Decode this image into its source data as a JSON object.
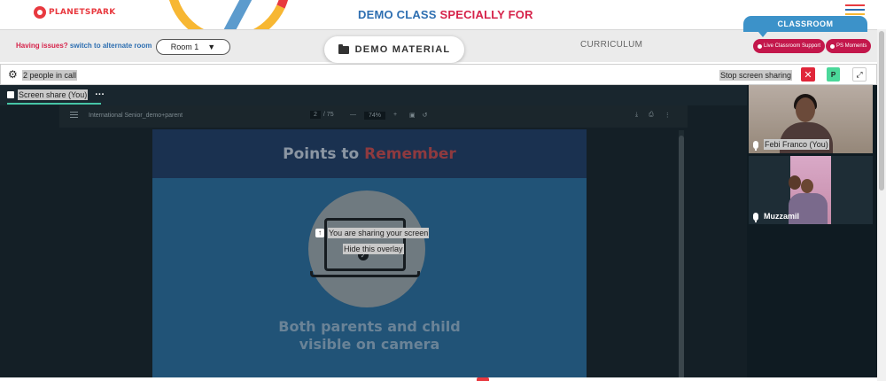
{
  "header": {
    "logo_text": "PLANETSPARK",
    "headline_part1": "DEMO CLASS",
    "headline_part2": "SPECIALLY FOR"
  },
  "classbar": {
    "issues_label": "Having issues?",
    "alternate_link": "switch to alternate room",
    "room_select_value": "Room 1",
    "demo_tab_label": "DEMO MATERIAL",
    "curriculum_tab_label": "CURRICULUM",
    "classroom_label": "CLASSROOM",
    "support_button": "Live Classroom Support",
    "moments_button": "PS Moments"
  },
  "call": {
    "people_count": "2 people in call",
    "stop_sharing_label": "Stop screen sharing",
    "p_button_label": "P"
  },
  "share": {
    "tab_label": "Screen share (You)",
    "overlay_message": "You are sharing your screen",
    "hide_overlay": "Hide this overlay"
  },
  "pdf": {
    "doc_title": "International Senior_demo+parent",
    "page_current": "2",
    "page_total": "/ 75",
    "zoom_minus": "—",
    "zoom_value": "74%",
    "zoom_plus": "+"
  },
  "slide": {
    "title_plain": "Points to",
    "title_accent": "Remember",
    "caption_line1": "Both parents and child",
    "caption_line2": "visible on camera"
  },
  "participants": [
    {
      "name": "Febi Franco (You)"
    },
    {
      "name": "Muzzamil"
    }
  ],
  "colors": {
    "brand_red": "#e8393f",
    "brand_blue": "#2e6fb1",
    "accent_crimson": "#c3174b",
    "classroom_blue": "#3c92c9",
    "stage_bg": "#0f1b22"
  },
  "icons": {
    "gear": "gear-icon",
    "close": "close-icon",
    "expand": "expand-icon",
    "mic": "mic-icon",
    "folder": "folder-icon",
    "menu": "hamburger-icon"
  }
}
